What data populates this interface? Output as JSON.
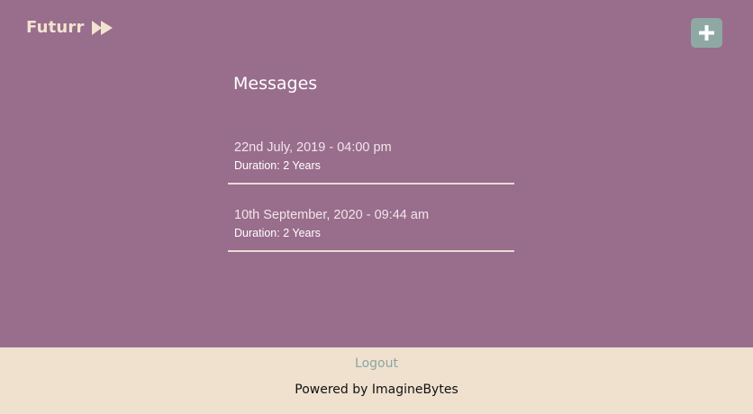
{
  "header": {
    "brand": "Futurr",
    "brand_icon": "fast-forward-icon",
    "add_icon": "plus-icon"
  },
  "main": {
    "title": "Messages",
    "messages": [
      {
        "date": "22nd July, 2019 - 04:00 pm",
        "duration": "Duration: 2 Years"
      },
      {
        "date": "10th September, 2020 - 09:44 am",
        "duration": "Duration: 2 Years"
      }
    ]
  },
  "footer": {
    "logout": "Logout",
    "powered_by": "Powered by ImagineBytes"
  },
  "colors": {
    "background": "#996d8c",
    "footer_background": "#f0e1cf",
    "accent": "#8fa8a4",
    "brand_text": "#f2e3d1"
  }
}
